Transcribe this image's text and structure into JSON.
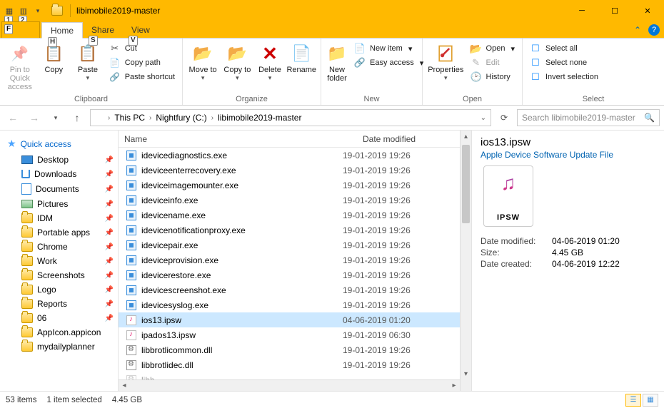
{
  "window": {
    "title": "libimobile2019-master"
  },
  "key_hints": {
    "qat1": "1",
    "qat2": "2",
    "file": "F",
    "home": "H",
    "share": "S",
    "view": "V"
  },
  "tabs": {
    "file": "File",
    "home": "Home",
    "share": "Share",
    "view": "View"
  },
  "ribbon": {
    "clipboard": {
      "label": "Clipboard",
      "pin": "Pin to Quick access",
      "copy": "Copy",
      "paste": "Paste",
      "cut": "Cut",
      "copy_path": "Copy path",
      "paste_shortcut": "Paste shortcut"
    },
    "organize": {
      "label": "Organize",
      "move_to": "Move to",
      "copy_to": "Copy to",
      "delete": "Delete",
      "rename": "Rename"
    },
    "new": {
      "label": "New",
      "new_folder": "New folder",
      "new_item": "New item",
      "easy_access": "Easy access"
    },
    "open": {
      "label": "Open",
      "properties": "Properties",
      "open": "Open",
      "edit": "Edit",
      "history": "History"
    },
    "select": {
      "label": "Select",
      "select_all": "Select all",
      "select_none": "Select none",
      "invert": "Invert selection"
    }
  },
  "address": {
    "this_pc": "This PC",
    "drive": "Nightfury (C:)",
    "folder": "libimobile2019-master"
  },
  "search_placeholder": "Search libimobile2019-master",
  "nav": {
    "quick_access": "Quick access",
    "items": [
      {
        "label": "Desktop",
        "pinned": true,
        "icon": "desktop"
      },
      {
        "label": "Downloads",
        "pinned": true,
        "icon": "downloads"
      },
      {
        "label": "Documents",
        "pinned": true,
        "icon": "docs"
      },
      {
        "label": "Pictures",
        "pinned": true,
        "icon": "pics"
      },
      {
        "label": "IDM",
        "pinned": true,
        "icon": "folder"
      },
      {
        "label": "Portable apps",
        "pinned": true,
        "icon": "folder"
      },
      {
        "label": "Chrome",
        "pinned": true,
        "icon": "folder"
      },
      {
        "label": "Work",
        "pinned": true,
        "icon": "folder"
      },
      {
        "label": "Screenshots",
        "pinned": true,
        "icon": "folder"
      },
      {
        "label": "Logo",
        "pinned": true,
        "icon": "folder"
      },
      {
        "label": "Reports",
        "pinned": true,
        "icon": "folder"
      },
      {
        "label": "06",
        "pinned": true,
        "icon": "folder"
      },
      {
        "label": "AppIcon.appicon",
        "pinned": false,
        "icon": "folder"
      },
      {
        "label": "mydailyplanner",
        "pinned": false,
        "icon": "folder"
      }
    ]
  },
  "columns": {
    "name": "Name",
    "date": "Date modified"
  },
  "files": [
    {
      "name": "idevicediagnostics.exe",
      "date": "19-01-2019 19:26",
      "type": "exe"
    },
    {
      "name": "ideviceenterrecovery.exe",
      "date": "19-01-2019 19:26",
      "type": "exe"
    },
    {
      "name": "ideviceimagemounter.exe",
      "date": "19-01-2019 19:26",
      "type": "exe"
    },
    {
      "name": "ideviceinfo.exe",
      "date": "19-01-2019 19:26",
      "type": "exe"
    },
    {
      "name": "idevicename.exe",
      "date": "19-01-2019 19:26",
      "type": "exe"
    },
    {
      "name": "idevicenotificationproxy.exe",
      "date": "19-01-2019 19:26",
      "type": "exe"
    },
    {
      "name": "idevicepair.exe",
      "date": "19-01-2019 19:26",
      "type": "exe"
    },
    {
      "name": "ideviceprovision.exe",
      "date": "19-01-2019 19:26",
      "type": "exe"
    },
    {
      "name": "idevicerestore.exe",
      "date": "19-01-2019 19:26",
      "type": "exe"
    },
    {
      "name": "idevicescreenshot.exe",
      "date": "19-01-2019 19:26",
      "type": "exe"
    },
    {
      "name": "idevicesyslog.exe",
      "date": "19-01-2019 19:26",
      "type": "exe"
    },
    {
      "name": "ios13.ipsw",
      "date": "04-06-2019 01:20",
      "type": "ipsw",
      "selected": true
    },
    {
      "name": "ipados13.ipsw",
      "date": "19-01-2019 06:30",
      "type": "ipsw"
    },
    {
      "name": "libbrotlicommon.dll",
      "date": "19-01-2019 19:26",
      "type": "dll"
    },
    {
      "name": "libbrotlidec.dll",
      "date": "19-01-2019 19:26",
      "type": "dll"
    }
  ],
  "preview": {
    "title": "ios13.ipsw",
    "subtitle": "Apple Device Software Update File",
    "ext": "IPSW",
    "props": [
      {
        "k": "Date modified:",
        "v": "04-06-2019 01:20"
      },
      {
        "k": "Size:",
        "v": "4.45 GB"
      },
      {
        "k": "Date created:",
        "v": "04-06-2019 12:22"
      }
    ]
  },
  "status": {
    "count": "53 items",
    "selected": "1 item selected",
    "size": "4.45 GB"
  }
}
